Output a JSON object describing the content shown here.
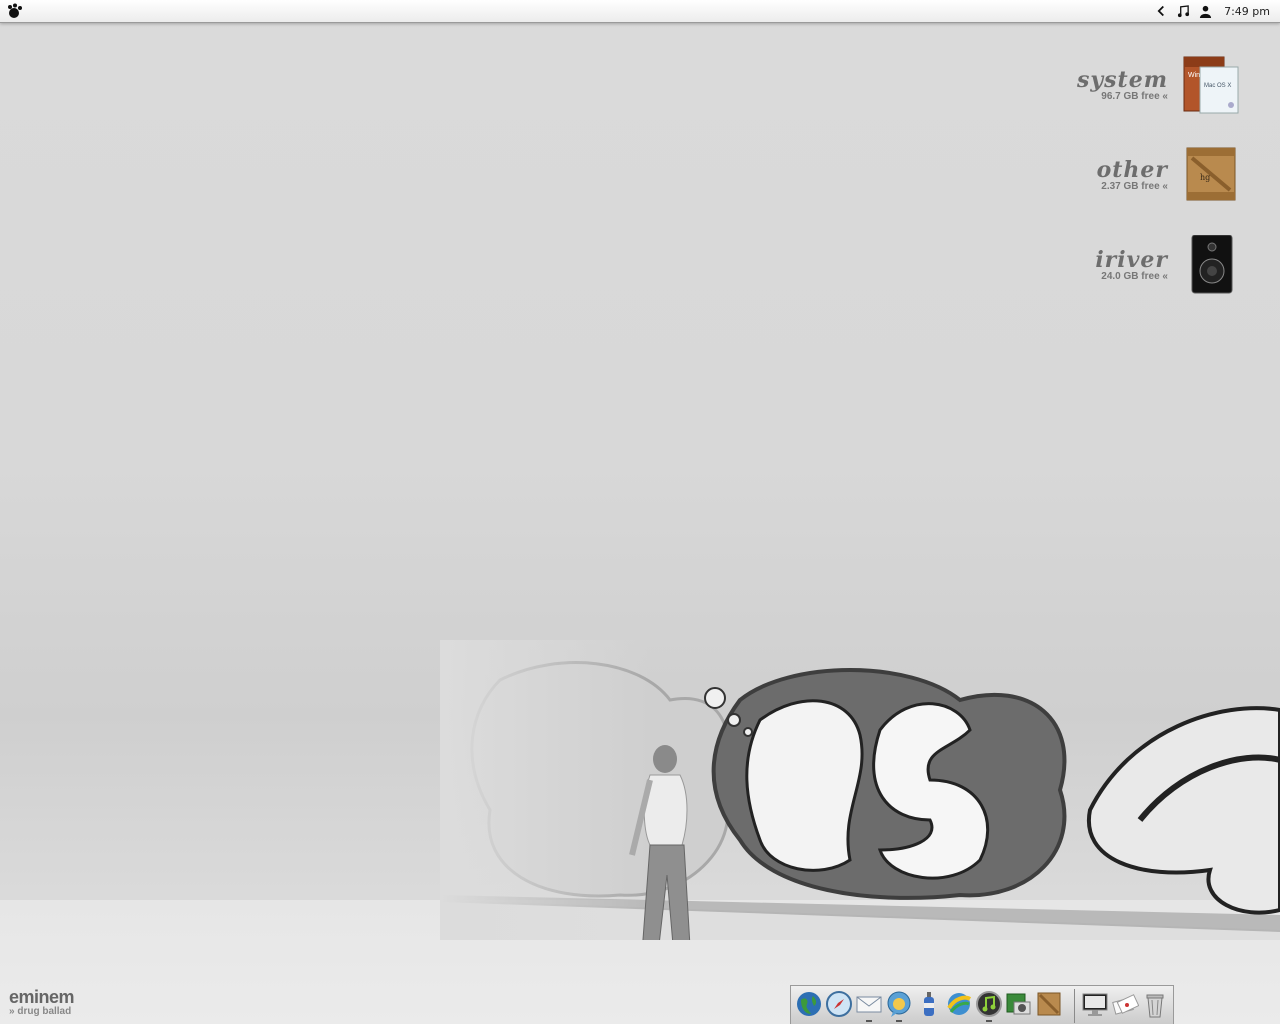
{
  "menubar": {
    "logo_icon": "paw-logo-icon",
    "status_icons": [
      "chevron-left-icon",
      "music-note-icon",
      "user-icon"
    ],
    "clock": "7:49 pm"
  },
  "drives": [
    {
      "name": "system",
      "free": "96.7 GB free  «",
      "icon": "install-disc-icon"
    },
    {
      "name": "other",
      "free": "2.37 GB free  «",
      "icon": "wooden-crate-icon"
    },
    {
      "name": "iriver",
      "free": "24.0 GB free  «",
      "icon": "speaker-icon"
    }
  ],
  "caption": {
    "title": "eminem",
    "subtitle": "» drug ballad"
  },
  "dock": {
    "apps": [
      "globe-icon",
      "safari-compass-icon",
      "mail-icon",
      "ichat-icon",
      "bottle-icon",
      "network-icon",
      "itunes-icon",
      "iphoto-icon",
      "crate-icon"
    ],
    "extras": [
      "monitor-icon",
      "mail-stack-icon",
      "trash-icon"
    ]
  }
}
